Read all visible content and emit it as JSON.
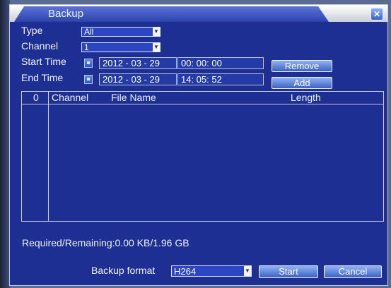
{
  "window": {
    "title": "Backup",
    "close_icon": "✕"
  },
  "type": {
    "label": "Type",
    "value": "All"
  },
  "channel": {
    "label": "Channel",
    "value": "1"
  },
  "start_time": {
    "label": "Start Time",
    "date": "2012 - 03 - 29",
    "time": "00: 00: 00"
  },
  "end_time": {
    "label": "End Time",
    "date": "2012 - 03 - 29",
    "time": "14: 05: 52"
  },
  "buttons": {
    "remove": "Remove",
    "add": "Add",
    "start": "Start",
    "cancel": "Cancel"
  },
  "table": {
    "columns": [
      "0",
      "Channel",
      "File Name",
      "Length"
    ],
    "rows": []
  },
  "status": "Required/Remaining:0.00 KB/1.96 GB",
  "backup_format": {
    "label": "Backup format",
    "value": "H264"
  },
  "icons": {
    "close": "close-icon",
    "calendar": "calendar-icon",
    "dropdown": "chevron-down-icon"
  }
}
